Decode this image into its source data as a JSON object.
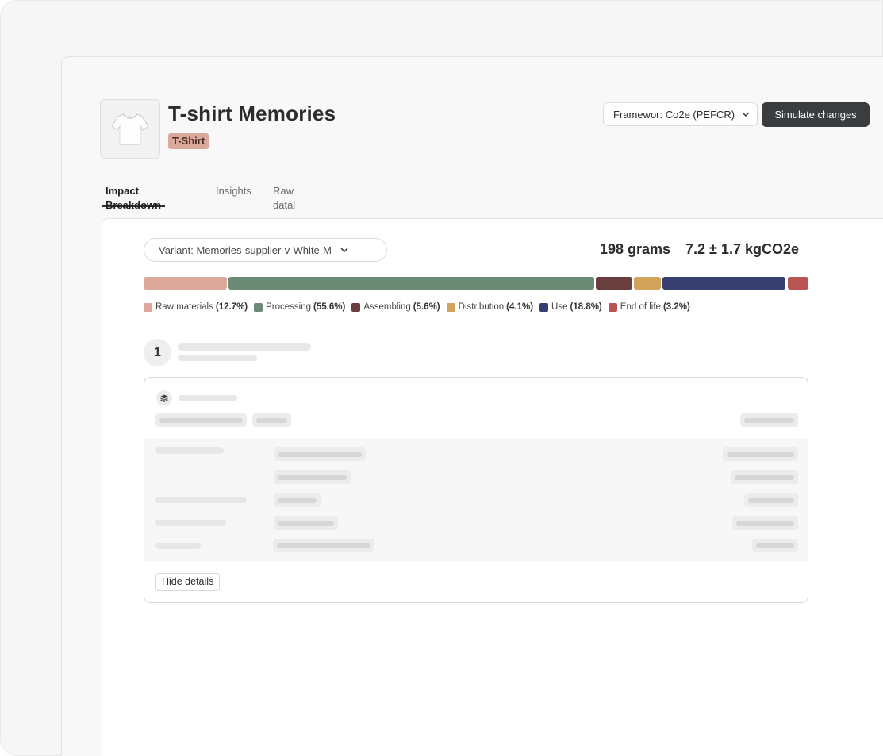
{
  "product": {
    "title": "T-shirt Memories",
    "category_tag": "T-Shirt",
    "thumbnail_icon": "tshirt-icon"
  },
  "header": {
    "framework_label": "Framewor: Co2e (PEFCR)",
    "simulate_button": "Simulate changes"
  },
  "tabs": [
    {
      "label": "Impact Breakdown",
      "active": true
    },
    {
      "label": "Insights",
      "active": false
    },
    {
      "label": "Raw datal",
      "active": false
    }
  ],
  "panel": {
    "variant_label": "Variant: Memories-supplier-v-White-M",
    "weight": "198 grams",
    "emissions": "7.2 ± 1.7 kgCO2e",
    "breakdown": [
      {
        "name": "Raw materials",
        "percent_label": "(12.7%)",
        "percent": 12.7,
        "color": "#dca99c"
      },
      {
        "name": "Processing",
        "percent_label": "(55.6%)",
        "percent": 55.6,
        "color": "#6b8b76"
      },
      {
        "name": "Assembling",
        "percent_label": "(5.6%)",
        "percent": 5.6,
        "color": "#6a3e3f"
      },
      {
        "name": "Distribution",
        "percent_label": "(4.1%)",
        "percent": 4.1,
        "color": "#d2a35b"
      },
      {
        "name": "Use",
        "percent_label": "(18.8%)",
        "percent": 18.8,
        "color": "#363f6f"
      },
      {
        "name": "End of life",
        "percent_label": "(3.2%)",
        "percent": 3.2,
        "color": "#b95454"
      }
    ],
    "step_number": "1",
    "hide_details_button": "Hide details",
    "card_icon": "layers-icon"
  }
}
